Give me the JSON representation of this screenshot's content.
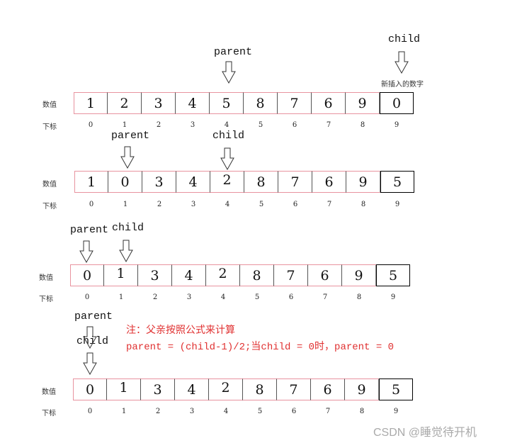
{
  "labels": {
    "value": "数值",
    "index": "下标"
  },
  "colors": {
    "array_border": "#e8939f",
    "new_cell_border": "#000000",
    "note": "#e03030",
    "watermark": "#aaaaaa"
  },
  "steps": [
    {
      "values": [
        "1",
        "2",
        "3",
        "4",
        "5",
        "8",
        "7",
        "6",
        "9",
        "0"
      ],
      "indices": [
        "0",
        "1",
        "2",
        "3",
        "4",
        "5",
        "6",
        "7",
        "8",
        "9"
      ],
      "pointers": [
        {
          "text": "parent",
          "index": 4
        },
        {
          "text": "child",
          "index": 9
        }
      ],
      "new_item_label": "新插入的数字"
    },
    {
      "values": [
        "1",
        "0",
        "3",
        "4",
        "2",
        "8",
        "7",
        "6",
        "9",
        "5"
      ],
      "indices": [
        "0",
        "1",
        "2",
        "3",
        "4",
        "5",
        "6",
        "7",
        "8",
        "9"
      ],
      "pointers": [
        {
          "text": "parent",
          "index": 1
        },
        {
          "text": "child",
          "index": 4
        }
      ]
    },
    {
      "values": [
        "0",
        "1",
        "3",
        "4",
        "2",
        "8",
        "7",
        "6",
        "9",
        "5"
      ],
      "indices": [
        "0",
        "1",
        "2",
        "3",
        "4",
        "5",
        "6",
        "7",
        "8",
        "9"
      ],
      "pointers": [
        {
          "text": "parent",
          "index": 0
        },
        {
          "text": "child",
          "index": 1
        }
      ]
    },
    {
      "values": [
        "0",
        "1",
        "3",
        "4",
        "2",
        "8",
        "7",
        "6",
        "9",
        "5"
      ],
      "indices": [
        "0",
        "1",
        "2",
        "3",
        "4",
        "5",
        "6",
        "7",
        "8",
        "9"
      ],
      "pointers": [
        {
          "text": "parent",
          "index": 0
        },
        {
          "text": "child",
          "index": 0
        }
      ]
    }
  ],
  "note": {
    "line1": "注：父亲按照公式来计算",
    "line2": "parent = (child-1)/2;当child = 0时，parent = 0"
  },
  "watermark": "CSDN @睡觉待开机"
}
